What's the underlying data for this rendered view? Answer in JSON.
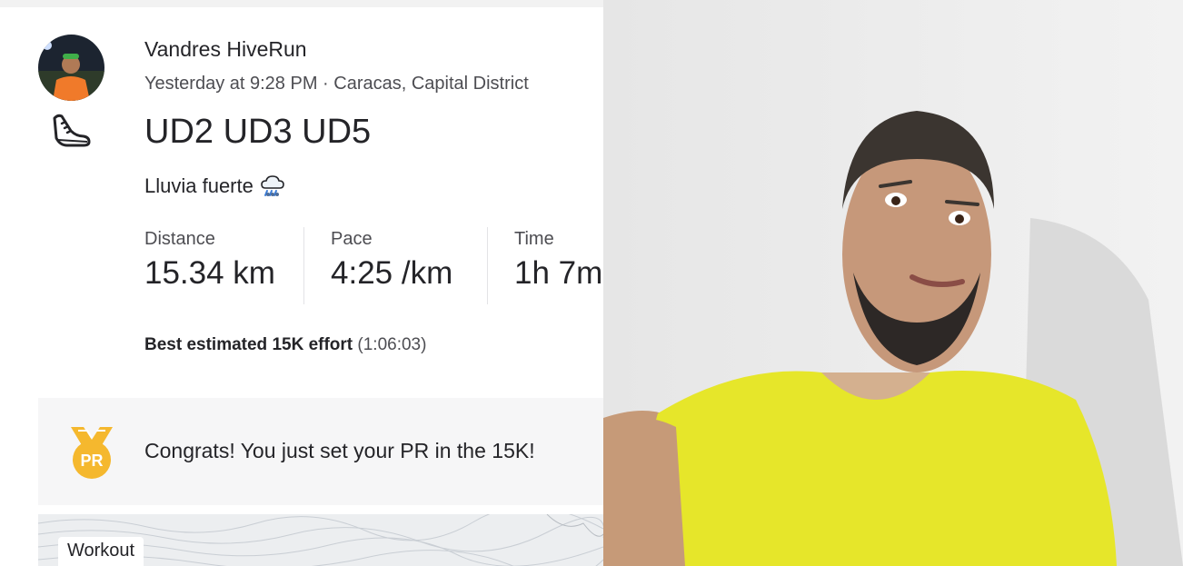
{
  "activity": {
    "athlete_name": "Vandres HiveRun",
    "meta": "Yesterday at 9:28 PM · Caracas, Capital District",
    "title": "UD2 UD3 UD5",
    "description": "Lluvia fuerte",
    "sport_icon": "running-shoe-icon",
    "weather_icon": "heavy-rain-cloud-icon"
  },
  "stats": [
    {
      "label": "Distance",
      "value": "15.34 km"
    },
    {
      "label": "Pace",
      "value": "4:25 /km"
    },
    {
      "label": "Time",
      "value": "1h 7m"
    }
  ],
  "best_effort": {
    "label": "Best estimated 15K effort",
    "time": "(1:06:03)"
  },
  "pr_card": {
    "text": "Congrats! You just set your PR in the 15K!",
    "medal_label": "PR",
    "icon": "pr-medal-icon"
  },
  "map": {
    "badge": "Workout"
  },
  "colors": {
    "medal_gold": "#f5b82e",
    "shirt_yellow": "#e6e62a"
  }
}
